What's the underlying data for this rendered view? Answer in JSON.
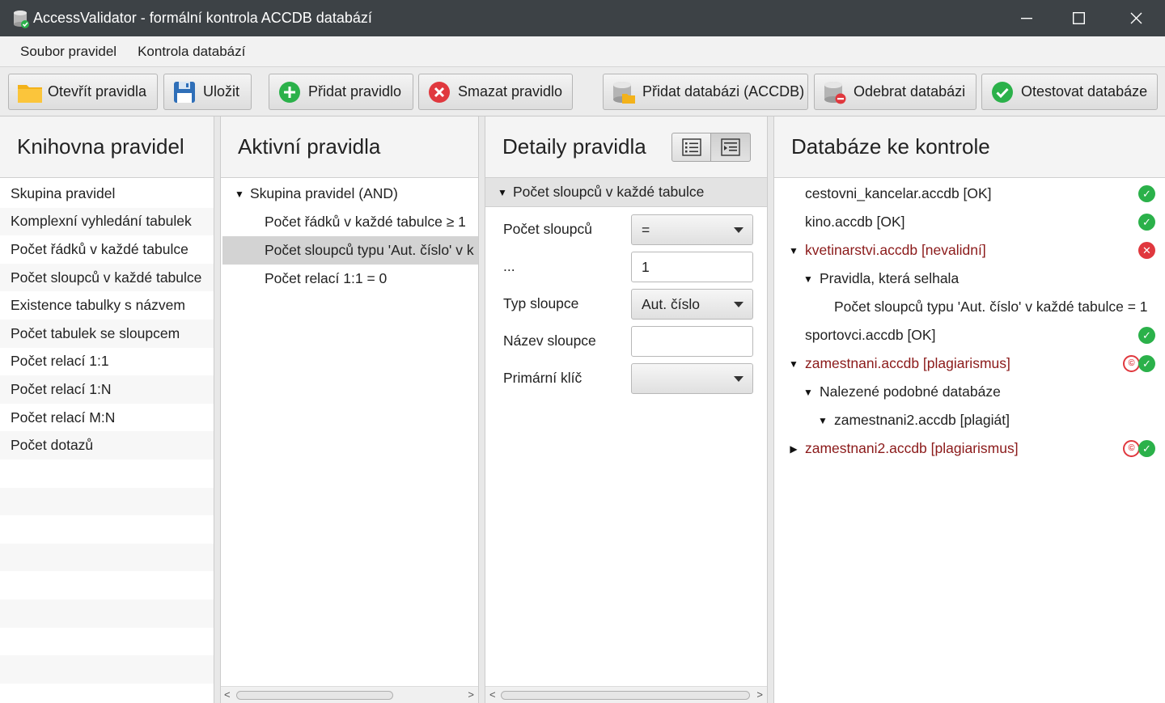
{
  "window": {
    "title": "AccessValidator - formální kontrola ACCDB databází",
    "controls": {
      "minimize": "—",
      "maximize": "☐",
      "close": "✕"
    }
  },
  "menu": {
    "items": [
      "Soubor pravidel",
      "Kontrola databází"
    ]
  },
  "toolbar": {
    "open_rules": "Otevřít pravidla",
    "save": "Uložit",
    "add_rule": "Přidat pravidlo",
    "delete_rule": "Smazat pravidlo",
    "add_database": "Přidat databázi (ACCDB)",
    "remove_database": "Odebrat databázi",
    "test_databases": "Otestovat databáze"
  },
  "library": {
    "title": "Knihovna pravidel",
    "items": [
      "Skupina pravidel",
      "Komplexní vyhledání tabulek",
      "Počet řádků v každé tabulce",
      "Počet sloupců v každé tabulce",
      "Existence tabulky s názvem",
      "Počet tabulek se sloupcem",
      "Počet relací 1:1",
      "Počet relací 1:N",
      "Počet relací M:N",
      "Počet dotazů"
    ]
  },
  "active": {
    "title": "Aktivní pravidla",
    "root": "Skupina pravidel (AND)",
    "rules": [
      "Počet řádků v každé tabulce ≥ 1",
      "Počet sloupců typu 'Aut. číslo' v k",
      "Počet relací 1:1 = 0"
    ],
    "selected_index": 1
  },
  "details": {
    "title": "Detaily pravidla",
    "section": "Počet sloupců v každé tabulce",
    "fields": {
      "count_label": "Počet sloupců",
      "operator": "=",
      "value_label": "...",
      "value": "1",
      "column_type_label": "Typ sloupce",
      "column_type": "Aut. číslo",
      "column_name_label": "Název sloupce",
      "column_name": "",
      "primary_key_label": "Primární klíč",
      "primary_key": ""
    }
  },
  "databases": {
    "title": "Databáze ke kontrole",
    "rows": [
      {
        "text": "cestovni_kancelar.accdb [OK]",
        "status": "ok"
      },
      {
        "text": "kino.accdb [OK]",
        "status": "ok"
      },
      {
        "text": "kvetinarstvi.accdb [nevalidní]",
        "status": "error"
      },
      {
        "text": "Pravidla, která selhala"
      },
      {
        "text": "Počet sloupců typu 'Aut. číslo' v každé tabulce = 1"
      },
      {
        "text": "sportovci.accdb [OK]",
        "status": "ok"
      },
      {
        "text": "zamestnani.accdb [plagiarismus]",
        "status": "plagiarism"
      },
      {
        "text": "Nalezené podobné databáze"
      },
      {
        "text": "zamestnani2.accdb [plagiát]"
      },
      {
        "text": "zamestnani2.accdb [plagiarismus]",
        "status": "plagiarism"
      }
    ]
  },
  "colors": {
    "titlebar": "#3d4246",
    "ok": "#2bb14a",
    "error": "#e0383e",
    "invalid_text": "#8b1a1a"
  }
}
